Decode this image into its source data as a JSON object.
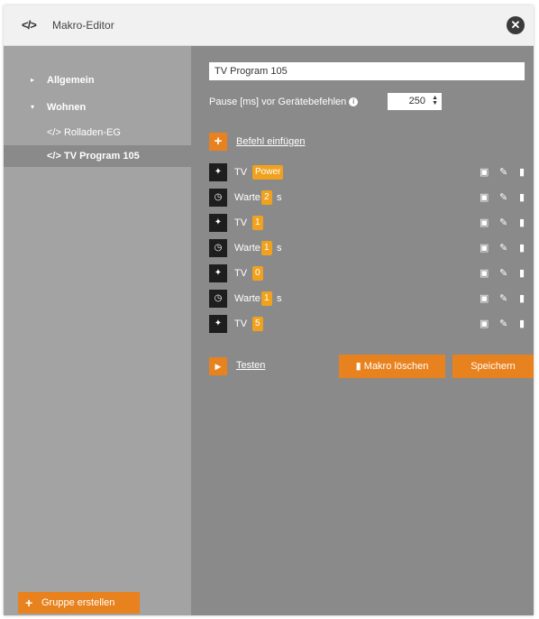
{
  "window": {
    "title": "Makro-Editor",
    "title_icon": "</>",
    "close_icon": "✕"
  },
  "sidebar": {
    "items": [
      {
        "label": "Allgemein",
        "arrow": "▸"
      },
      {
        "label": "Wohnen",
        "arrow": "▾"
      },
      {
        "label": "Rolladen-EG",
        "prefix": "</>"
      },
      {
        "label": "TV Program 105",
        "prefix": "</>"
      }
    ],
    "create_group_label": "Gruppe erstellen"
  },
  "editor": {
    "macro_name": "TV Program 105",
    "pause_label": "Pause [ms] vor Gerätebefehlen",
    "pause_value": "250",
    "add_command_label": "Befehl einfügen",
    "commands": [
      {
        "type": "device",
        "text": "TV",
        "value": "Power",
        "unit": ""
      },
      {
        "type": "wait",
        "text": "Warte",
        "value": "2",
        "unit": "s"
      },
      {
        "type": "device",
        "text": "TV",
        "value": "1",
        "unit": ""
      },
      {
        "type": "wait",
        "text": "Warte",
        "value": "1",
        "unit": "s"
      },
      {
        "type": "device",
        "text": "TV",
        "value": "0",
        "unit": ""
      },
      {
        "type": "wait",
        "text": "Warte",
        "value": "1",
        "unit": "s"
      },
      {
        "type": "device",
        "text": "TV",
        "value": "5",
        "unit": ""
      }
    ],
    "test_label": "Testen",
    "delete_label": "Makro löschen",
    "save_label": "Speichern"
  },
  "colors": {
    "accent": "#e8821e",
    "badge": "#f0a21e",
    "panel": "#8a8a8a",
    "sidebar": "#a3a3a3"
  }
}
